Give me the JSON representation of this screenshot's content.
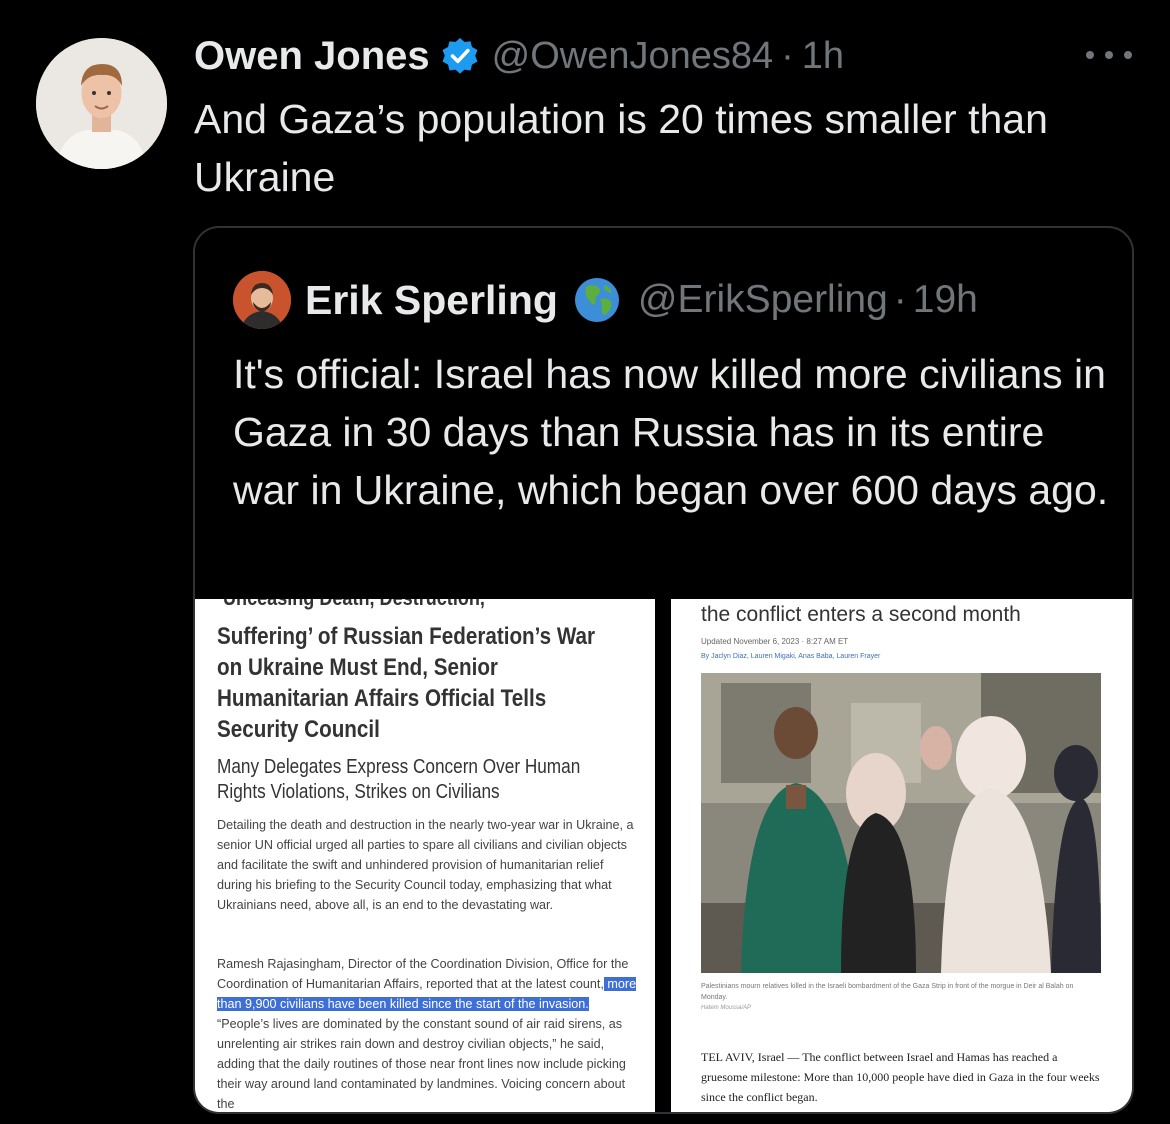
{
  "tweet": {
    "author_name": "Owen Jones",
    "handle": "@OwenJones84",
    "separator": "·",
    "time": "1h",
    "text": "And Gaza’s population is 20 times smaller than Ukraine"
  },
  "quoted_tweet": {
    "author_name": "Erik Sperling",
    "handle": "@ErikSperling",
    "separator": "·",
    "time": "19h",
    "text": "It's official:  Israel has now  killed more civilians in Gaza in 30 days than Russia has in its entire war in Ukraine, which began over 600 days ago."
  },
  "media_left": {
    "cut_heading": "Unceasing Death, Destruction,",
    "title": "Suffering’ of Russian Federation’s War on Ukraine Must End, Senior Humanitarian Affairs Official Tells Security Council",
    "subtitle": "Many Delegates Express Concern Over Human Rights Violations, Strikes on Civilians",
    "paragraph1": "Detailing the death and destruction in the nearly two-year war in Ukraine, a senior UN official urged all parties to spare all civilians and civilian objects and facilitate the swift and unhindered provision of humanitarian relief during his briefing to the Security Council today, emphasizing that what Ukrainians need, above all, is an end to the devastating war.",
    "paragraph2_before": "Ramesh Rajasingham, Director of the Coordination Division, Office for the Coordination of Humanitarian Affairs, reported that at the latest count,",
    "paragraph2_highlight": " more than 9,900 civilians have been killed since the start of the invasion.",
    "paragraph2_after": " “People’s lives are dominated by the constant sound of air raid sirens, as unrelenting air strikes rain down and destroy civilian objects,” he said, adding that the daily routines of those near front lines now include picking their way around land contaminated by landmines.  Voicing concern about the"
  },
  "media_right": {
    "title": "the conflict enters a second month",
    "updated": "Updated November 6, 2023 · 8:27 AM ET",
    "byline": "By Jaclyn Diaz, Lauren Migaki, Anas Baba, Lauren Frayer",
    "caption": "Palestinians mourn relatives killed in the Israeli bombardment of the Gaza Strip in front of the morgue in Deir al Balah on Monday.",
    "credit": "Hatem Moussa/AP",
    "body": "TEL AVIV, Israel — The conflict between Israel and Hamas has reached a gruesome milestone: More than 10,000 people have died in Gaza in the four weeks since the conflict began."
  },
  "icons": {
    "verified": "verified-badge-icon",
    "globe": "globe-emoji-icon",
    "more": "more-options-icon"
  },
  "colors": {
    "background": "#000000",
    "text_primary": "#e7e9ea",
    "text_secondary": "#71767b",
    "verified_blue": "#1d9bf0",
    "highlight": "#3d6fd6"
  }
}
